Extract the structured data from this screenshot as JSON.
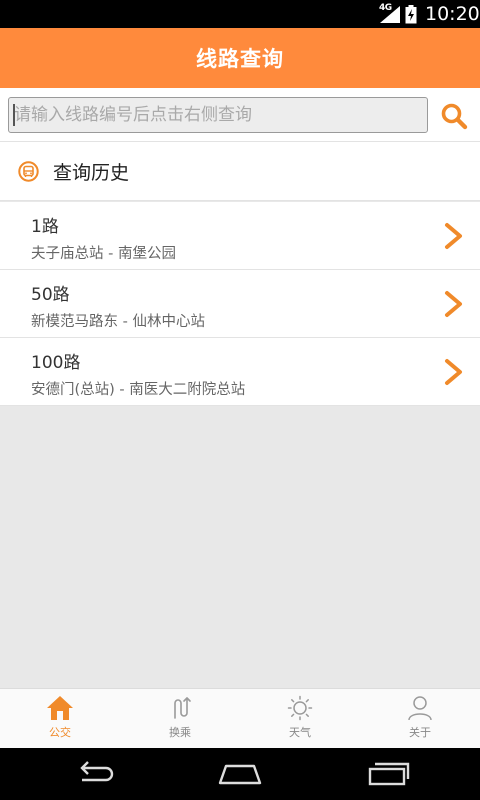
{
  "status_bar": {
    "network": "4G",
    "time": "10:20"
  },
  "header": {
    "title": "线路查询"
  },
  "search": {
    "placeholder": "请输入线路编号后点击右侧查询",
    "value": ""
  },
  "history": {
    "title": "查询历史",
    "items": [
      {
        "name": "1路",
        "desc": "夫子庙总站 - 南堡公园"
      },
      {
        "name": "50路",
        "desc": "新模范马路东 - 仙林中心站"
      },
      {
        "name": "100路",
        "desc": "安德门(总站) - 南医大二附院总站"
      }
    ]
  },
  "bottom_nav": {
    "items": [
      {
        "label": "公交",
        "icon": "home-icon",
        "active": true
      },
      {
        "label": "换乘",
        "icon": "transfer-icon",
        "active": false
      },
      {
        "label": "天气",
        "icon": "sun-icon",
        "active": false
      },
      {
        "label": "关于",
        "icon": "user-icon",
        "active": false
      }
    ]
  },
  "colors": {
    "accent": "#ff8a3c",
    "icon_orange": "#f08a2a",
    "background": "#e8e8e8"
  }
}
